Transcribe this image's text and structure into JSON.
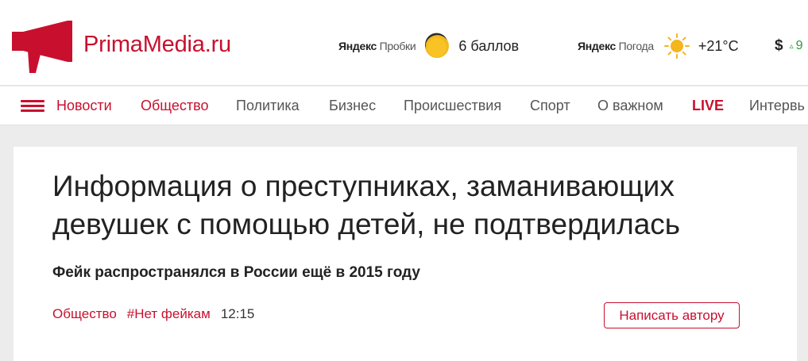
{
  "brand": {
    "name": "PrimaMedia.ru",
    "accent_color": "#c8102e",
    "logo_icon": "megaphone-icon"
  },
  "header": {
    "traffic": {
      "yandex_brand": "Яндекс",
      "service": "Пробки",
      "value": "6 баллов",
      "icon": "traffic-jam-icon"
    },
    "weather": {
      "yandex_brand": "Яндекс",
      "service": "Погода",
      "value": "+21°C",
      "icon": "sun-icon"
    },
    "currency": {
      "sign": "$",
      "trend": "▵",
      "value": "9"
    }
  },
  "nav": {
    "menu_icon": "hamburger-menu-icon",
    "items": [
      {
        "label": "Новости"
      },
      {
        "label": "Общество"
      },
      {
        "label": "Политика"
      },
      {
        "label": "Бизнес"
      },
      {
        "label": "Происшествия"
      },
      {
        "label": "Спорт"
      },
      {
        "label": "О важном"
      },
      {
        "label": "LIVE"
      },
      {
        "label": "Интервь"
      }
    ]
  },
  "article": {
    "title": "Информация о преступниках, заманивающих девушек с помощью детей, не подтвердилась",
    "subtitle": "Фейк распространялся в России ещё в 2015 году",
    "tags": [
      "Общество",
      "#Нет фейкам"
    ],
    "time": "12:15",
    "write_author_label": "Написать автору"
  }
}
